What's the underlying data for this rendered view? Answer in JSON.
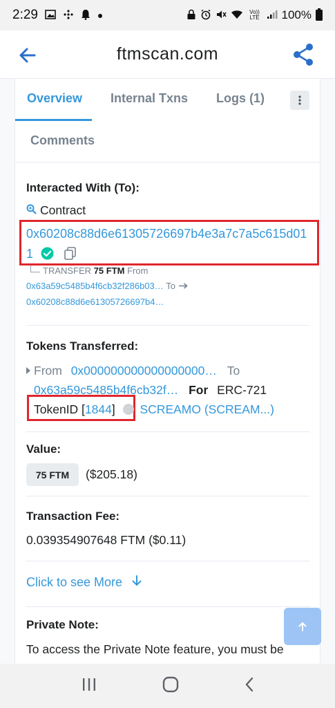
{
  "status_bar": {
    "time": "2:29",
    "network": "4G",
    "volte": "Vo)) LTE",
    "battery": "100%"
  },
  "app_bar": {
    "title": "ftmscan.com"
  },
  "tabs": {
    "overview": "Overview",
    "internal_txns": "Internal Txns",
    "logs": "Logs (1)",
    "comments": "Comments"
  },
  "interacted": {
    "label": "Interacted With (To):",
    "contract_label": "Contract",
    "address": "0x60208c88d6e61305726697b4e3a7c7a5c615d011",
    "transfer_prefix": "TRANSFER",
    "transfer_amount": "75 FTM",
    "from_word": "From",
    "from_address": "0x63a59c5485b4f6cb32f286b03…",
    "to_word": "To",
    "to_address": "0x60208c88d6e61305726697b4…"
  },
  "tokens": {
    "label": "Tokens Transferred:",
    "from_word": "From",
    "from_address": "0x000000000000000000…",
    "to_word": "To",
    "to_address": "0x63a59c5485b4f6cb32f…",
    "for_word": "For",
    "standard": "ERC-721",
    "token_id_label": "TokenID [",
    "token_id": "1844",
    "token_id_close": "]",
    "token_name": "SCREAMO (SCREAM...)"
  },
  "value": {
    "label": "Value:",
    "amount": "75 FTM",
    "usd": "($205.18)"
  },
  "fee": {
    "label": "Transaction Fee:",
    "amount": "0.039354907648 FTM ($0.11)"
  },
  "more": {
    "label": "Click to see More"
  },
  "note": {
    "label": "Private Note:",
    "text": "To access the Private Note feature, you must be"
  },
  "colors": {
    "link": "#3498db",
    "highlight_box": "#e0262d",
    "verified": "#00c9a7"
  }
}
